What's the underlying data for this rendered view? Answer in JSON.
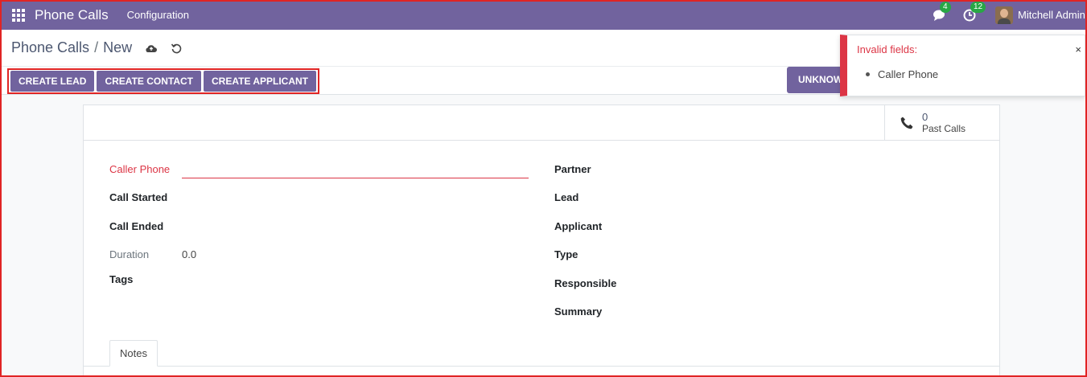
{
  "navbar": {
    "app_name": "Phone Calls",
    "menu_configuration": "Configuration",
    "messages_count": "4",
    "activities_count": "12",
    "user_name": "Mitchell Admin"
  },
  "breadcrumb": {
    "parent": "Phone Calls",
    "separator": "/",
    "current": "New"
  },
  "actions": {
    "create_lead": "CREATE LEAD",
    "create_contact": "CREATE CONTACT",
    "create_applicant": "CREATE APPLICANT",
    "unknown": "UNKNOWN"
  },
  "toast": {
    "title": "Invalid fields:",
    "close": "×",
    "items": [
      "Caller Phone"
    ]
  },
  "stat_button": {
    "value": "0",
    "label": "Past Calls"
  },
  "form": {
    "left": {
      "caller_phone_label": "Caller Phone",
      "call_started_label": "Call Started",
      "call_ended_label": "Call Ended",
      "duration_label": "Duration",
      "duration_value": "0.0",
      "tags_label": "Tags"
    },
    "right": {
      "partner_label": "Partner",
      "lead_label": "Lead",
      "applicant_label": "Applicant",
      "type_label": "Type",
      "responsible_label": "Responsible",
      "summary_label": "Summary"
    }
  },
  "tabs": {
    "notes": "Notes"
  },
  "colors": {
    "brand": "#71639e",
    "danger": "#dc3545",
    "badge": "#28a745",
    "highlight": "#e02424"
  }
}
